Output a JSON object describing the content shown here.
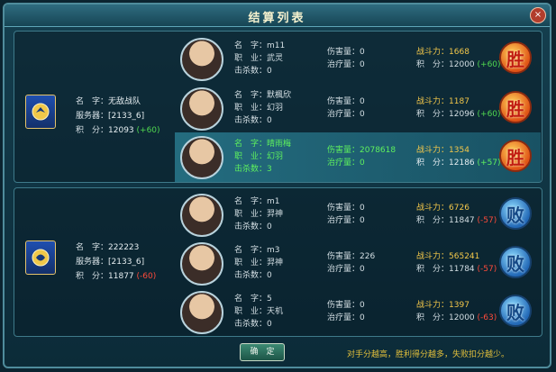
{
  "window": {
    "title": "结算列表",
    "close_label": "×"
  },
  "labels": {
    "name": "名　字：",
    "job": "职　业：",
    "kills": "击杀数：",
    "damage": "伤害量：",
    "healing": "治疗量：",
    "power": "战斗力：",
    "points": "积　分：",
    "team_name": "名　字：",
    "server": "服务器：",
    "team_points": "积　分："
  },
  "teams": [
    {
      "name": "无敌战队",
      "server": "[2133_6]",
      "points": "12093",
      "delta": "(+60)",
      "delta_color": "#50d850",
      "flag_glyph": "鸡",
      "players": [
        {
          "name": "m11",
          "job": "武灵",
          "kills": "0",
          "damage": "0",
          "healing": "0",
          "power": "1668",
          "points": "12000",
          "delta": "(+60)",
          "result": "胜",
          "highlight": false
        },
        {
          "name": "默楓欣",
          "job": "幻羽",
          "kills": "0",
          "damage": "0",
          "healing": "0",
          "power": "1187",
          "points": "12096",
          "delta": "(+60)",
          "result": "胜",
          "highlight": false
        },
        {
          "name": "晴雨梅",
          "job": "幻羽",
          "kills": "3",
          "damage": "2078618",
          "healing": "0",
          "power": "1354",
          "points": "12186",
          "delta": "(+57)",
          "result": "胜",
          "highlight": true
        }
      ]
    },
    {
      "name": "222223",
      "server": "[2133_6]",
      "points": "11877",
      "delta": "(-60)",
      "delta_color": "#ff4a3a",
      "flag_glyph": "龙",
      "players": [
        {
          "name": "m1",
          "job": "羿神",
          "kills": "0",
          "damage": "0",
          "healing": "0",
          "power": "6726",
          "points": "11847",
          "delta": "(-57)",
          "result": "败",
          "highlight": false
        },
        {
          "name": "m3",
          "job": "羿神",
          "kills": "0",
          "damage": "226",
          "healing": "0",
          "power": "565241",
          "points": "11784",
          "delta": "(-57)",
          "result": "败",
          "highlight": false
        },
        {
          "name": "5",
          "job": "天机",
          "kills": "0",
          "damage": "0",
          "healing": "0",
          "power": "1397",
          "points": "12000",
          "delta": "(-63)",
          "result": "败",
          "highlight": false
        }
      ]
    }
  ],
  "footer": {
    "confirm_label": "确　定",
    "tip": "对手分越高，胜利得分越多，失败扣分越少。"
  },
  "colors": {
    "gain": "#50d850",
    "loss": "#ff4a3a",
    "accent": "#f4c84a"
  }
}
